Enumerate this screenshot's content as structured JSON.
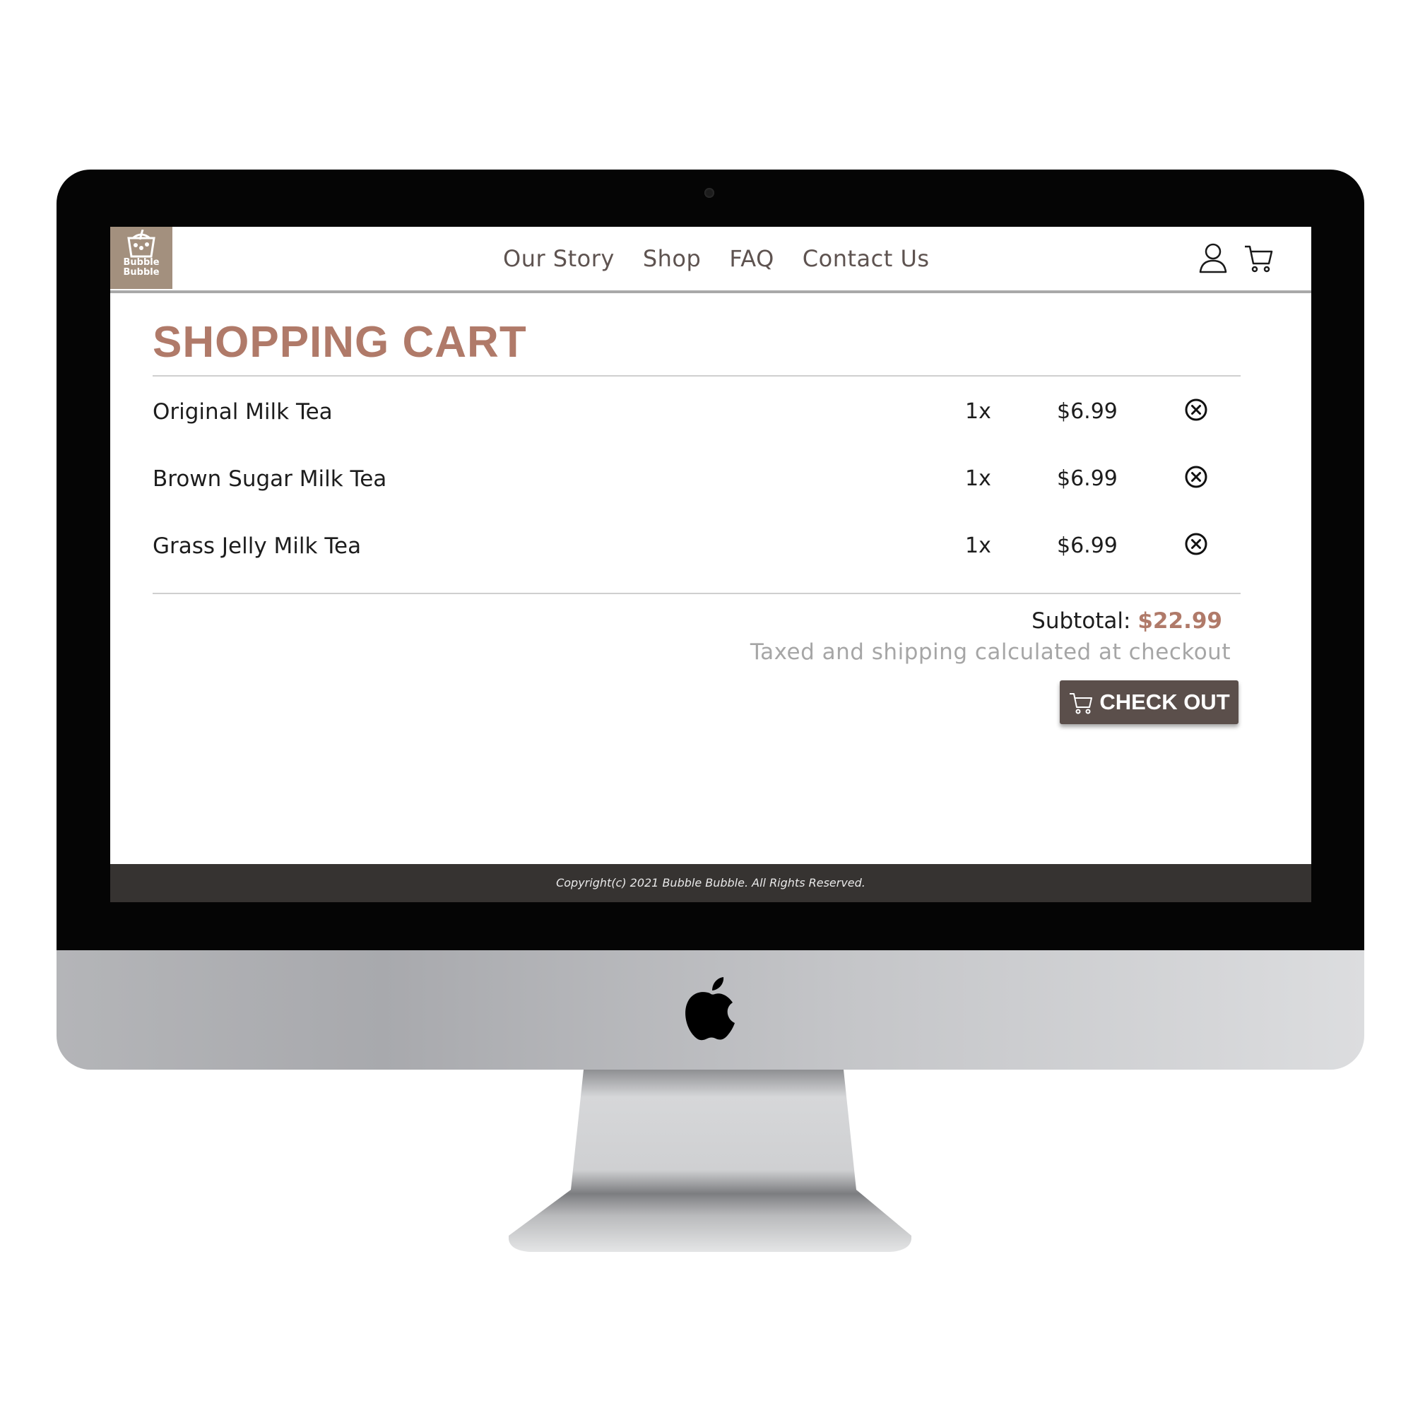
{
  "brand": {
    "logo_line1": "Bubble",
    "logo_line2": "Bubble"
  },
  "nav": {
    "items": [
      "Our Story",
      "Shop",
      "FAQ",
      "Contact Us"
    ]
  },
  "icons": {
    "account": "user-icon",
    "cart": "shopping-cart-icon",
    "remove": "remove-circle-x-icon",
    "checkout": "cart-icon",
    "device": "apple-logo-icon"
  },
  "cart": {
    "title": "SHOPPING CART",
    "items": [
      {
        "name": "Original Milk Tea",
        "qty": "1x",
        "price": "$6.99"
      },
      {
        "name": "Brown Sugar Milk Tea",
        "qty": "1x",
        "price": "$6.99"
      },
      {
        "name": "Grass Jelly Milk Tea",
        "qty": "1x",
        "price": "$6.99"
      }
    ],
    "subtotal_label": "Subtotal:",
    "subtotal_value": "$22.99",
    "note": "Taxed and shipping calculated at checkout",
    "checkout_label": "CHECK OUT"
  },
  "footer": {
    "copyright": "Copyright(c) 2021 Bubble Bubble. All Rights Reserved."
  },
  "colors": {
    "accent": "#b07a69",
    "button": "#5b4f4b",
    "footer": "#363331",
    "logo_bg": "#a3907e",
    "nav_text": "#5e5350",
    "note_text": "#a6a6a6"
  }
}
